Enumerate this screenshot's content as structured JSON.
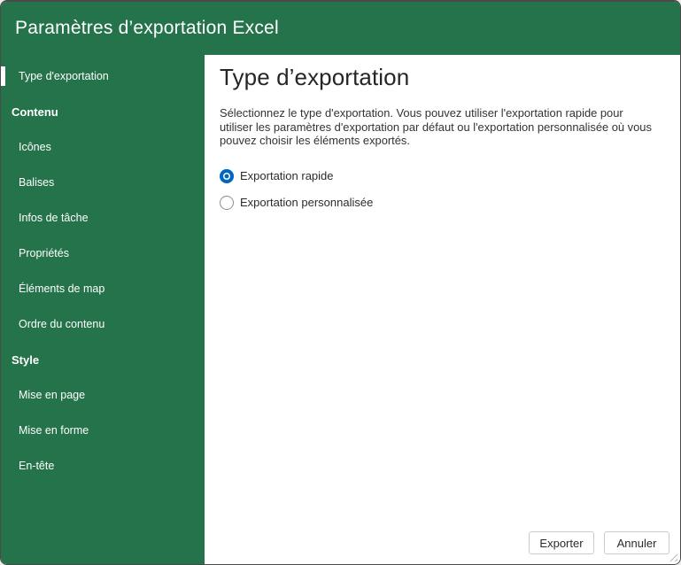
{
  "window": {
    "title": "Paramètres d’exportation Excel"
  },
  "colors": {
    "brand_green": "#24734a",
    "radio_selected_blue": "#0067c0",
    "selected_indicator": "#ffffff",
    "button_border": "#cbcbcb"
  },
  "sidebar": {
    "items": [
      {
        "label": "Type d'exportation",
        "type": "item",
        "selected": true
      },
      {
        "label": "Contenu",
        "type": "section"
      },
      {
        "label": "Icônes",
        "type": "item"
      },
      {
        "label": "Balises",
        "type": "item"
      },
      {
        "label": "Infos de tâche",
        "type": "item"
      },
      {
        "label": "Propriétés",
        "type": "item"
      },
      {
        "label": "Éléments de map",
        "type": "item"
      },
      {
        "label": "Ordre du contenu",
        "type": "item"
      },
      {
        "label": "Style",
        "type": "section"
      },
      {
        "label": "Mise en page",
        "type": "item"
      },
      {
        "label": "Mise en forme",
        "type": "item"
      },
      {
        "label": "En-tête",
        "type": "item"
      }
    ]
  },
  "main": {
    "title": "Type d’exportation",
    "description": "Sélectionnez le type d'exportation. Vous pouvez utiliser l'exportation rapide pour utiliser les paramètres d'exportation par défaut ou l'exportation personnalisée où vous pouvez choisir les éléments exportés.",
    "radios": [
      {
        "label": "Exportation rapide",
        "selected": true
      },
      {
        "label": "Exportation personnalisée",
        "selected": false
      }
    ]
  },
  "footer": {
    "export_label": "Exporter",
    "cancel_label": "Annuler"
  }
}
